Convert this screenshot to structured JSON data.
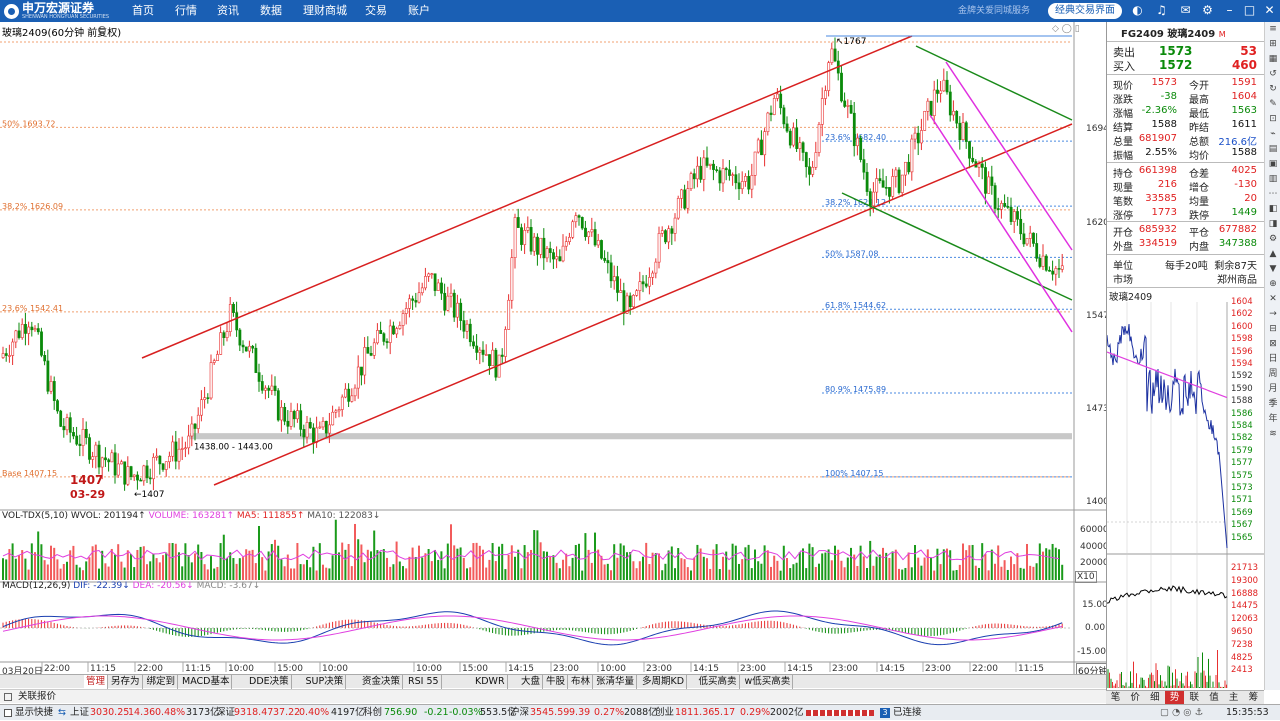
{
  "app": {
    "logo_name": "申万宏源证券",
    "logo_sub": "SHENWAN HONGYUAN SECURITIES",
    "menu": [
      "首页",
      "行情",
      "资讯",
      "数据",
      "理财商城",
      "交易",
      "账户"
    ],
    "tagline": "金牌关爱同城服务",
    "classic_button": "经典交易界面"
  },
  "chart": {
    "title": "玻璃2409(60分钟 前复权)",
    "price_axis": [
      "1694",
      "1620",
      "1547",
      "1473",
      "1400"
    ],
    "fib_left": [
      {
        "label": "50% 1693.72",
        "price": 1693.72
      },
      {
        "label": "38.2% 1626.09",
        "price": 1626.09
      },
      {
        "label": "23.6% 1542.41",
        "price": 1542.41
      },
      {
        "label": "Base 1407.15",
        "price": 1407.15
      }
    ],
    "fib_right": [
      {
        "label": "23.6% 1682.40",
        "price": 1682.4
      },
      {
        "label": "38.2% 1629.12",
        "price": 1629.12
      },
      {
        "label": "50% 1587.08",
        "price": 1587.08
      },
      {
        "label": "61.8% 1544.62",
        "price": 1544.62
      },
      {
        "label": "80.9% 1475.89",
        "price": 1475.89
      },
      {
        "label": "100% 1407.15",
        "price": 1407.15
      }
    ],
    "high_label": "1767",
    "low_label": "1407",
    "low_big": "1407",
    "low_date": "03-29",
    "zone_label": "1438.00 - 1443.00",
    "time_axis": [
      "03月20日",
      "22:00",
      "11:15",
      "22:00",
      "11:15",
      "10:00",
      "15:00",
      "10:00",
      "10:00",
      "15:00",
      "14:15",
      "23:00",
      "10:00",
      "23:00",
      "14:15",
      "23:00",
      "14:15",
      "23:00",
      "14:15",
      "23:00",
      "22:00",
      "11:15"
    ],
    "period_label": "60分钟"
  },
  "volume": {
    "header": "VOL-TDX(5,10)",
    "wvol": "WVOL: 201194↑",
    "volume": "VOLUME: 163281↑",
    "ma5": "MA5: 111855↑",
    "ma10": "MA10: 122083↓",
    "axis": [
      "60000",
      "40000",
      "20000"
    ],
    "unit": "X10",
    "colors": {
      "up": "#f25b5b",
      "down": "#1a9a1a"
    }
  },
  "macd": {
    "header": "MACD(12,26,9)",
    "dif": "DIF: -22.39↓",
    "dea": "DEA: -20.56↓",
    "macd": "MACD: -3.67↓",
    "axis": [
      "15.00",
      "0.00",
      "-15.00"
    ]
  },
  "quote": {
    "code": "FG2409",
    "name": "玻璃2409",
    "tag": "M",
    "sell": {
      "label": "卖出",
      "price": "1573",
      "vol": "53"
    },
    "buy": {
      "label": "买入",
      "price": "1572",
      "vol": "460"
    },
    "rows1": [
      {
        "k1": "现价",
        "v1": "1573",
        "c1": "red",
        "k2": "今开",
        "v2": "1591",
        "c2": "red"
      },
      {
        "k1": "涨跌",
        "v1": "-38",
        "c1": "green",
        "k2": "最高",
        "v2": "1604",
        "c2": "red"
      },
      {
        "k1": "涨幅",
        "v1": "-2.36%",
        "c1": "green",
        "k2": "最低",
        "v2": "1563",
        "c2": "green"
      },
      {
        "k1": "结算",
        "v1": "1588",
        "c1": "blk",
        "k2": "昨结",
        "v2": "1611",
        "c2": "blk"
      },
      {
        "k1": "总量",
        "v1": "681907",
        "c1": "red",
        "k2": "总额",
        "v2": "216.6亿",
        "c2": "blue"
      },
      {
        "k1": "振幅",
        "v1": "2.55%",
        "c1": "blk",
        "k2": "均价",
        "v2": "1588",
        "c2": "blk"
      }
    ],
    "rows2": [
      {
        "k1": "持仓",
        "v1": "661398",
        "c1": "red",
        "k2": "仓差",
        "v2": "4025",
        "c2": "red"
      },
      {
        "k1": "现量",
        "v1": "216",
        "c1": "red",
        "k2": "增仓",
        "v2": "-130",
        "c2": "red"
      },
      {
        "k1": "笔数",
        "v1": "33585",
        "c1": "red",
        "k2": "均量",
        "v2": "20",
        "c2": "red"
      },
      {
        "k1": "涨停",
        "v1": "1773",
        "c1": "red",
        "k2": "跌停",
        "v2": "1449",
        "c2": "green"
      }
    ],
    "rows3": [
      {
        "k1": "开仓",
        "v1": "685932",
        "c1": "red",
        "k2": "平仓",
        "v2": "677882",
        "c2": "red"
      },
      {
        "k1": "外盘",
        "v1": "334519",
        "c1": "red",
        "k2": "内盘",
        "v2": "347388",
        "c2": "green"
      }
    ],
    "unit_label": "单位",
    "unit_value": "每手20吨",
    "remaining": "剩余87天",
    "market_label": "市场",
    "market_value": "郑州商品"
  },
  "mini": {
    "title": "玻璃2409",
    "price_axis": [
      "1604",
      "1602",
      "1600",
      "1598",
      "1596",
      "1594",
      "1592",
      "1590",
      "1588",
      "1586",
      "1584",
      "1582",
      "1579",
      "1577",
      "1575",
      "1573",
      "1571",
      "1569",
      "1567",
      "1565"
    ],
    "vol_axis": [
      "21713",
      "19300",
      "16888",
      "14475",
      "12063",
      "9650",
      "7238",
      "4825",
      "2413"
    ],
    "tabs": [
      "笔",
      "价",
      "细",
      "势",
      "联",
      "值",
      "主",
      "筹"
    ],
    "active_tab": "势"
  },
  "rtools": [
    "≡",
    "⊞",
    "▦",
    "↺",
    "↻",
    "✎",
    "⊡",
    "⌁",
    "▤",
    "▣",
    "▥",
    "⋯",
    "◧",
    "◨",
    "⚙",
    "▲",
    "▼",
    "⊕",
    "✕",
    "→",
    "⊟",
    "⊠",
    "日",
    "周",
    "月",
    "季",
    "年",
    "≋"
  ],
  "bottom_tabs": [
    "管理",
    "另存为",
    "绑定到",
    "MACD基本",
    "DDE决策",
    "SUP决策",
    "资金决策",
    "RSI 55",
    "KDWR",
    "大盘",
    "牛股",
    "布林",
    "张清华量",
    "多周期KD",
    "低买高卖",
    "w低买高卖"
  ],
  "related": "关联报价",
  "status": {
    "quick": "显示快捷",
    "sh_label": "上证",
    "sh_val": "3030.25",
    "sh_chg": "14.36",
    "sh_pct": "0.48%",
    "sh_amt": "3173亿",
    "sz_label": "深证",
    "sz_val": "9318.47",
    "sz_chg": "37.22",
    "sz_pct": "0.40%",
    "sz_amt": "4197亿",
    "kc_label": "科创",
    "kc_val": "756.90",
    "kc_chg": "-0.21",
    "kc_pct": "-0.03%",
    "kc_amt": "553.5亿",
    "hs_label": "沪深",
    "hs_val": "3545.59",
    "hs_chg": "9.39",
    "hs_pct": "0.27%",
    "hs_amt": "2088亿",
    "cy_label": "创业",
    "cy_val": "1811.36",
    "cy_chg": "5.17",
    "cy_pct": "0.29%",
    "cy_amt": "2002亿",
    "conn_num": "3",
    "connected": "已连接",
    "time": "15:35:53"
  }
}
